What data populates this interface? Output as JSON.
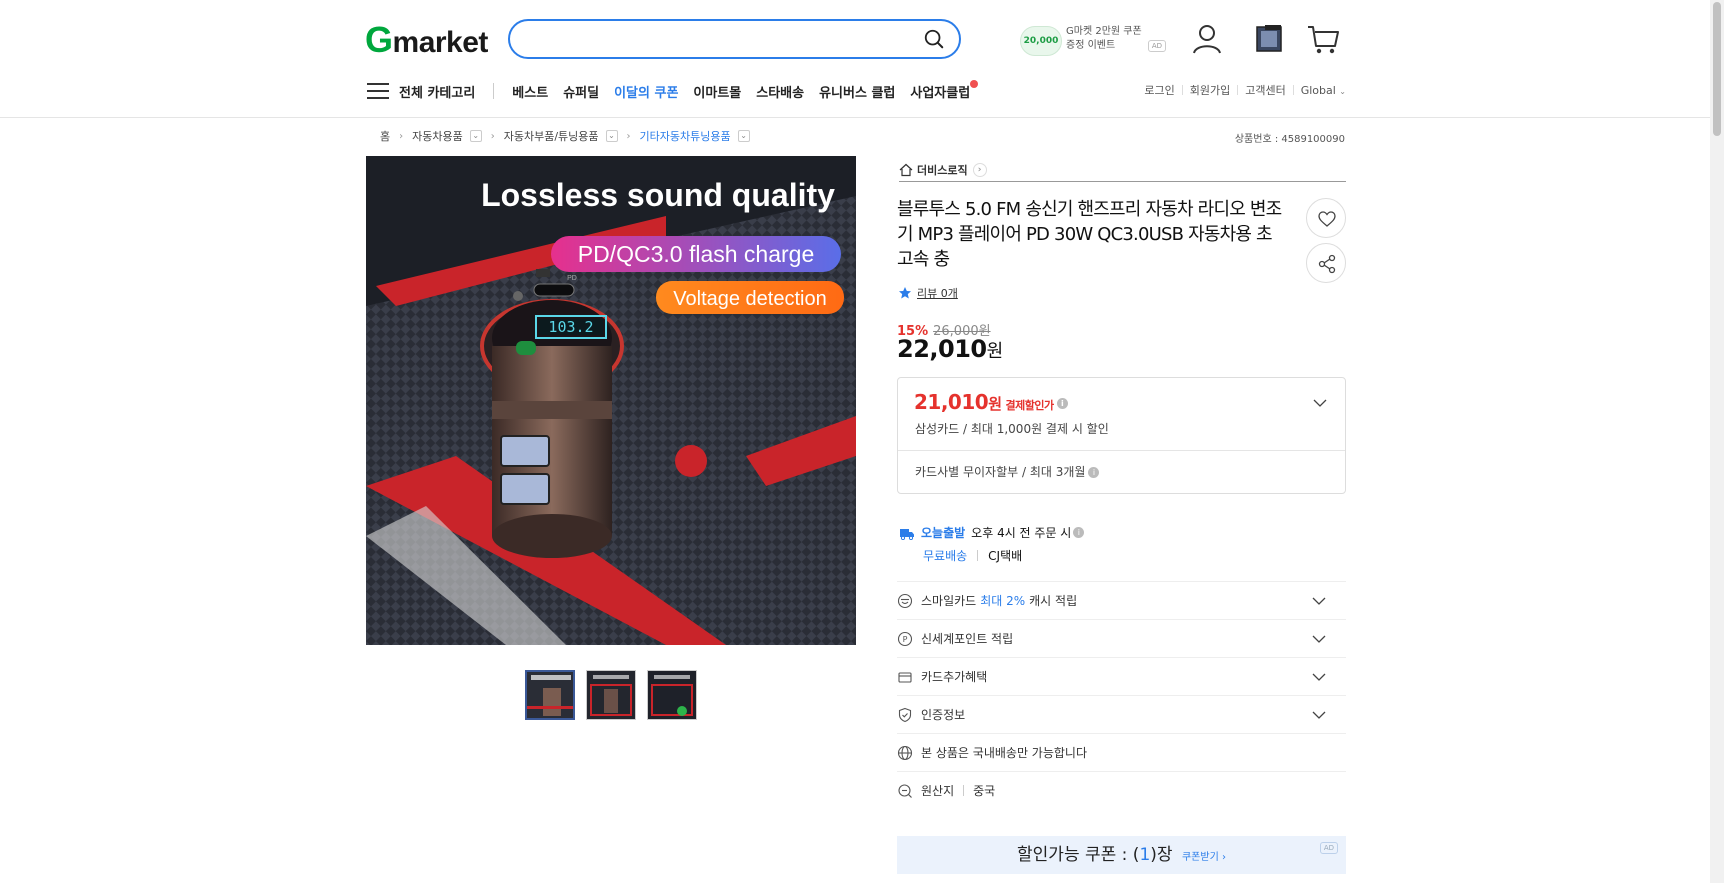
{
  "header": {
    "logo_g": "G",
    "logo_rest": "market",
    "search_placeholder": "",
    "coupon_ad": {
      "badge": "20,000",
      "line1": "G마켓 2만원 쿠폰",
      "line2": "증정 이벤트",
      "ad": "AD"
    }
  },
  "nav": {
    "all_categories": "전체 카테고리",
    "links": [
      "베스트",
      "슈퍼딜",
      "이달의 쿠폰",
      "이마트몰",
      "스타배송",
      "유니버스 클럽",
      "사업자클럽"
    ],
    "util": [
      "로그인",
      "회원가입",
      "고객센터",
      "Global"
    ]
  },
  "breadcrumb": [
    "홈",
    "자동차용품",
    "자동차부품/튜닝용품",
    "기타자동차튜닝용품"
  ],
  "product_number": "상품번호 : 4589100090",
  "product": {
    "seller": "더비스로직",
    "title": "블루투스 5.0 FM 송신기 핸즈프리 자동차 라디오 변조기 MP3 플레이어 PD 30W QC3.0USB 자동차용 초고속 충",
    "review": "리뷰 0개",
    "discount_pct": "15%",
    "original_price": "26,000원",
    "price": "22,010",
    "price_unit": "원",
    "pay_price": "21,010",
    "pay_unit": "원",
    "pay_label": "결제할인가",
    "pay_desc": "삼성카드 / 최대 1,000원 결제 시 할인",
    "installment": "카드사별 무이자할부 / 최대 3개월",
    "image_texts": {
      "line1": "Lossless sound quality",
      "line2": "PD/QC3.0 flash charge",
      "line3": "Voltage detection",
      "display": "103.2",
      "pd": "PD"
    }
  },
  "shipping": {
    "today_label": "오늘출발",
    "today_desc": "오후 4시 전 주문 시",
    "free": "무료배송",
    "carrier": "CJ택배"
  },
  "rows": {
    "smile_pre": "스마일카드",
    "smile_blue": "최대 2%",
    "smile_post": "캐시 적립",
    "shinsegae": "신세계포인트 적립",
    "card_benefit": "카드추가혜택",
    "cert": "인증정보",
    "domestic": "본 상품은 국내배송만 가능합니다",
    "origin_label": "원산지",
    "origin_value": "중국"
  },
  "coupon_banner": {
    "pre": "할인가능 쿠폰 : (",
    "num": "1",
    "post": ")장",
    "get": "쿠폰받기 ›",
    "ad": "AD"
  },
  "colors": {
    "brand_green": "#00a73d",
    "accent_blue": "#2b7de9",
    "discount_red": "#e5322d"
  }
}
